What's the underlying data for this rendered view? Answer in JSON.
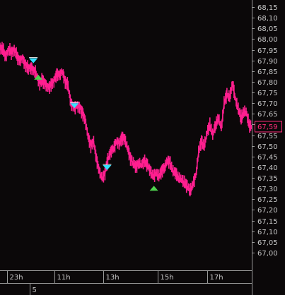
{
  "colors": {
    "background": "#0b0809",
    "axis": "#9a9a9a",
    "candle": "#ff1f8f",
    "current_price": "#ff2d7a",
    "sell_signal": "#33e0ff",
    "buy_signal": "#4fd24f",
    "text": "#c8c8c8"
  },
  "chart_data": {
    "type": "line",
    "y_ticks": [
      "68,15",
      "68,10",
      "68,05",
      "68,00",
      "67,95",
      "67,90",
      "67,85",
      "67,80",
      "67,75",
      "67,70",
      "67,65",
      "67,60",
      "67,55",
      "67,50",
      "67,45",
      "67,40",
      "67,35",
      "67,30",
      "67,25",
      "67,20",
      "67,15",
      "67,10",
      "67,05",
      "67,00"
    ],
    "y_tick_values": [
      68.15,
      68.1,
      68.05,
      68.0,
      67.95,
      67.9,
      67.85,
      67.8,
      67.75,
      67.7,
      67.65,
      67.6,
      67.55,
      67.5,
      67.45,
      67.4,
      67.35,
      67.3,
      67.25,
      67.2,
      67.15,
      67.1,
      67.05,
      67.0
    ],
    "ylim": [
      67.0,
      68.15
    ],
    "x_labels": [
      {
        "label": "23h",
        "at": 10
      },
      {
        "label": "11h",
        "at": 77
      },
      {
        "label": "13h",
        "at": 146
      },
      {
        "label": "15h",
        "at": 222
      },
      {
        "label": "17h",
        "at": 292
      }
    ],
    "x_range": [
      0,
      355
    ],
    "sub_label": {
      "label": "5",
      "at": 42
    },
    "current_price": {
      "label": "67,59",
      "value": 67.59
    },
    "series": [
      {
        "values": [
          [
            0,
            67.96
          ],
          [
            4,
            67.95
          ],
          [
            8,
            67.92
          ],
          [
            12,
            67.95
          ],
          [
            16,
            67.94
          ],
          [
            20,
            67.95
          ],
          [
            24,
            67.92
          ],
          [
            28,
            67.9
          ],
          [
            32,
            67.91
          ],
          [
            36,
            67.88
          ],
          [
            40,
            67.86
          ],
          [
            44,
            67.87
          ],
          [
            48,
            67.85
          ],
          [
            52,
            67.83
          ],
          [
            56,
            67.79
          ],
          [
            60,
            67.81
          ],
          [
            64,
            67.79
          ],
          [
            68,
            67.77
          ],
          [
            72,
            67.79
          ],
          [
            76,
            67.8
          ],
          [
            80,
            67.84
          ],
          [
            84,
            67.83
          ],
          [
            88,
            67.85
          ],
          [
            92,
            67.8
          ],
          [
            96,
            67.78
          ],
          [
            100,
            67.7
          ],
          [
            104,
            67.68
          ],
          [
            108,
            67.69
          ],
          [
            112,
            67.68
          ],
          [
            116,
            67.66
          ],
          [
            120,
            67.62
          ],
          [
            124,
            67.55
          ],
          [
            128,
            67.5
          ],
          [
            132,
            67.52
          ],
          [
            136,
            67.44
          ],
          [
            140,
            67.38
          ],
          [
            144,
            67.35
          ],
          [
            148,
            67.37
          ],
          [
            152,
            67.44
          ],
          [
            156,
            67.47
          ],
          [
            160,
            67.49
          ],
          [
            164,
            67.52
          ],
          [
            168,
            67.51
          ],
          [
            172,
            67.54
          ],
          [
            176,
            67.53
          ],
          [
            180,
            67.49
          ],
          [
            184,
            67.44
          ],
          [
            188,
            67.42
          ],
          [
            192,
            67.4
          ],
          [
            196,
            67.42
          ],
          [
            200,
            67.41
          ],
          [
            204,
            67.43
          ],
          [
            208,
            67.41
          ],
          [
            212,
            67.38
          ],
          [
            216,
            67.36
          ],
          [
            220,
            67.37
          ],
          [
            224,
            67.36
          ],
          [
            228,
            67.38
          ],
          [
            232,
            67.4
          ],
          [
            236,
            67.43
          ],
          [
            240,
            67.42
          ],
          [
            244,
            67.38
          ],
          [
            248,
            67.37
          ],
          [
            252,
            67.35
          ],
          [
            256,
            67.34
          ],
          [
            260,
            67.33
          ],
          [
            264,
            67.31
          ],
          [
            268,
            67.29
          ],
          [
            272,
            67.32
          ],
          [
            276,
            67.36
          ],
          [
            280,
            67.47
          ],
          [
            284,
            67.52
          ],
          [
            288,
            67.5
          ],
          [
            292,
            67.56
          ],
          [
            296,
            67.6
          ],
          [
            300,
            67.55
          ],
          [
            304,
            67.6
          ],
          [
            308,
            67.63
          ],
          [
            312,
            67.58
          ],
          [
            316,
            67.7
          ],
          [
            320,
            67.74
          ],
          [
            324,
            67.73
          ],
          [
            328,
            67.79
          ],
          [
            332,
            67.72
          ],
          [
            336,
            67.67
          ],
          [
            340,
            67.63
          ],
          [
            344,
            67.66
          ],
          [
            348,
            67.65
          ],
          [
            352,
            67.59
          ],
          [
            355,
            67.59
          ]
        ]
      }
    ],
    "signals": [
      {
        "type": "sell",
        "x": 47,
        "value": 67.9
      },
      {
        "type": "buy",
        "x": 54,
        "value": 67.82
      },
      {
        "type": "sell",
        "x": 105,
        "value": 67.69
      },
      {
        "type": "sell",
        "x": 151,
        "value": 67.4
      },
      {
        "type": "buy",
        "x": 217,
        "value": 67.3
      }
    ]
  }
}
